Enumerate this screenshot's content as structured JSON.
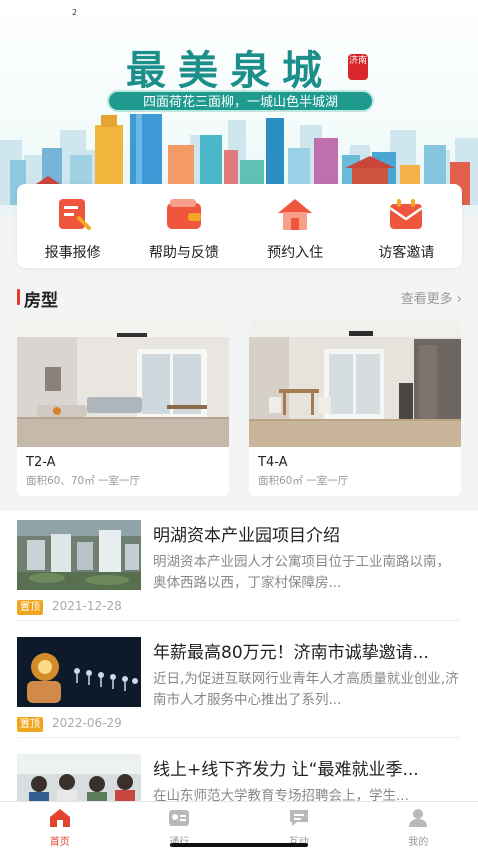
{
  "status_bar": {
    "indicator": "2"
  },
  "banner": {
    "title": "最美泉城",
    "seal_text": "济南",
    "slogan": "四面荷花三面柳，一城山色半城湖"
  },
  "quick_menu": [
    {
      "label": "报事报修",
      "icon": "repair-report-icon"
    },
    {
      "label": "帮助与反馈",
      "icon": "wallet-feedback-icon"
    },
    {
      "label": "预约入住",
      "icon": "house-icon"
    },
    {
      "label": "访客邀请",
      "icon": "invite-envelope-icon"
    }
  ],
  "room_section": {
    "title": "房型",
    "more_label": "查看更多",
    "more_icon": "chevron-right-icon"
  },
  "rooms": [
    {
      "name": "T2-A",
      "desc": "面积60、70㎡ 一室一厅"
    },
    {
      "name": "T4-A",
      "desc": "面积60㎡ 一室一厅"
    }
  ],
  "news": [
    {
      "title": "明湖资本产业园项目介绍",
      "summary": "明湖资本产业园人才公寓项目位于工业南路以南，奥体西路以西，丁家村保障房...",
      "tag": "置顶",
      "date": "2021-12-28"
    },
    {
      "title": "年薪最高80万元！济南市诚挚邀请...",
      "summary": "近日,为促进互联网行业青年人才高质量就业创业,济南市人才服务中心推出了系列...",
      "tag": "置顶",
      "date": "2022-06-29"
    },
    {
      "title": "线上+线下齐发力 让“最难就业季...",
      "summary": "在山东师范大学教育专场招聘会上，学生...",
      "tag": "",
      "date": ""
    }
  ],
  "tabbar": [
    {
      "label": "首页",
      "icon": "home-icon",
      "active": true
    },
    {
      "label": "通行",
      "icon": "access-card-icon",
      "active": false
    },
    {
      "label": "互动",
      "icon": "chat-icon",
      "active": false
    },
    {
      "label": "我的",
      "icon": "user-icon",
      "active": false
    }
  ],
  "colors": {
    "accent": "#e2442f",
    "brand_teal": "#1d8f8a",
    "tag_orange": "#f0a51e"
  }
}
